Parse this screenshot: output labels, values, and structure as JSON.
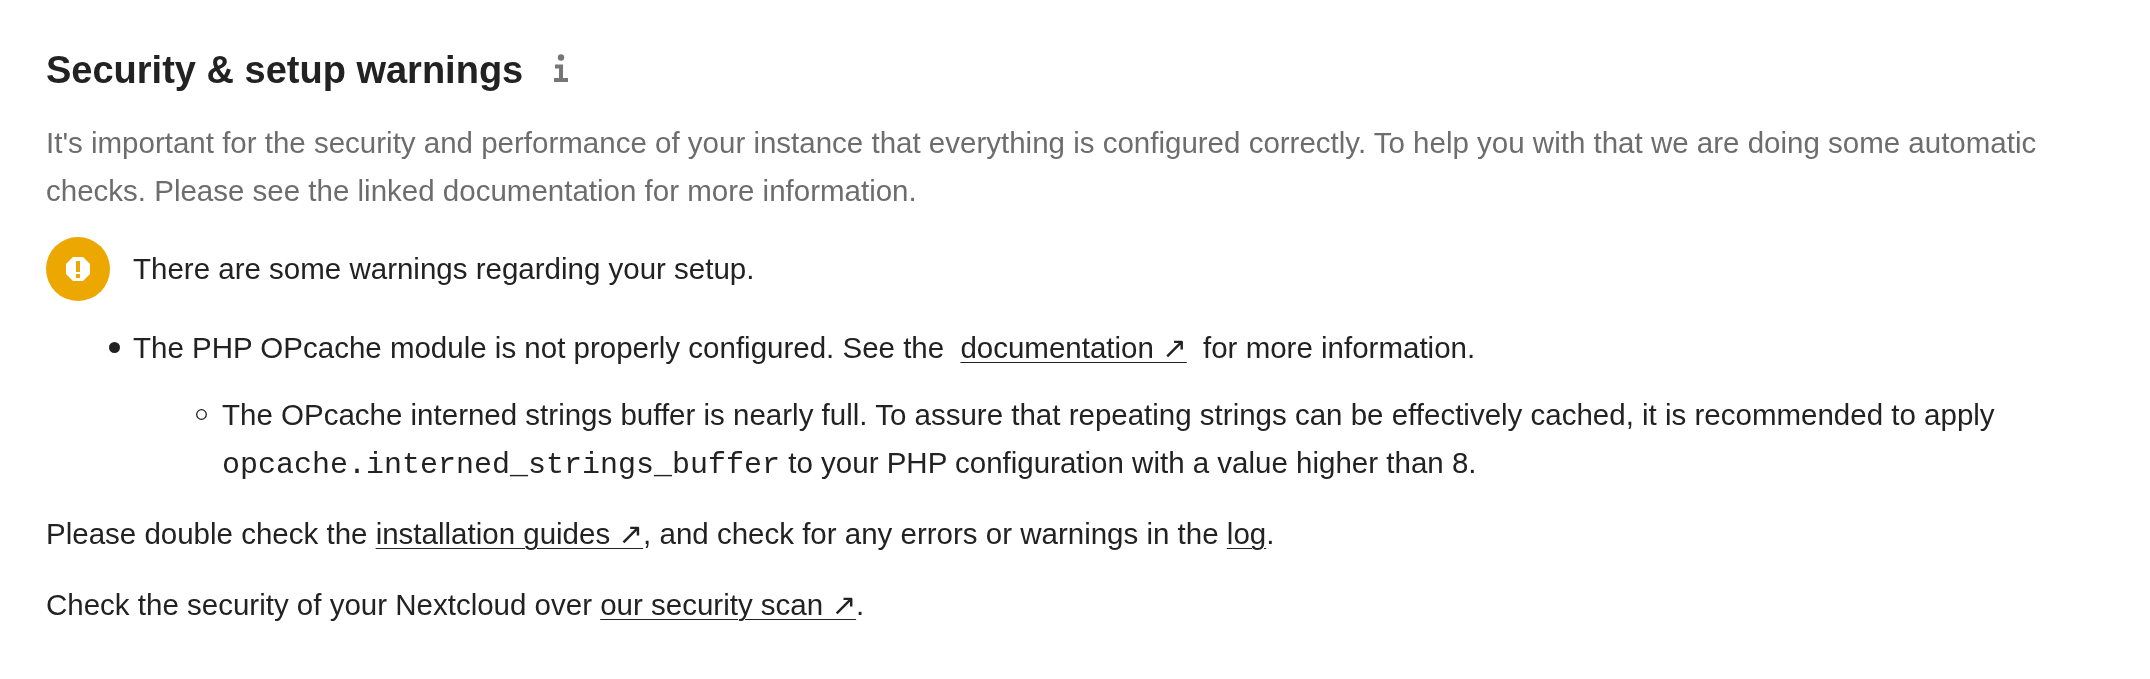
{
  "header": {
    "title": "Security & setup warnings"
  },
  "intro": "It's important for the security and performance of your instance that everything is configured correctly. To help you with that we are doing some automatic checks. Please see the linked documentation for more information.",
  "status": {
    "kind": "warning",
    "message": "There are some warnings regarding your setup."
  },
  "warnings": [
    {
      "parts": [
        {
          "kind": "text",
          "text": "The PHP OPcache module is not properly configured. See the "
        },
        {
          "kind": "link",
          "text": "documentation ↗"
        },
        {
          "kind": "text",
          "text": " for more information."
        }
      ],
      "children": [
        {
          "parts": [
            {
              "kind": "text",
              "text": "The OPcache interned strings buffer is nearly full. To assure that repeating strings can be effectively cached, it is recommended to apply "
            },
            {
              "kind": "code",
              "text": "opcache.interned_strings_buffer"
            },
            {
              "kind": "text",
              "text": " to your PHP configuration with a value higher than 8."
            }
          ]
        }
      ]
    }
  ],
  "footer": [
    {
      "parts": [
        {
          "kind": "text",
          "text": "Please double check the "
        },
        {
          "kind": "link",
          "text": "installation guides ↗"
        },
        {
          "kind": "text",
          "text": ", and check for any errors or warnings in the "
        },
        {
          "kind": "link",
          "text": "log"
        },
        {
          "kind": "text",
          "text": "."
        }
      ]
    },
    {
      "parts": [
        {
          "kind": "text",
          "text": "Check the security of your Nextcloud over "
        },
        {
          "kind": "link",
          "text": "our security scan ↗"
        },
        {
          "kind": "text",
          "text": "."
        }
      ]
    }
  ]
}
